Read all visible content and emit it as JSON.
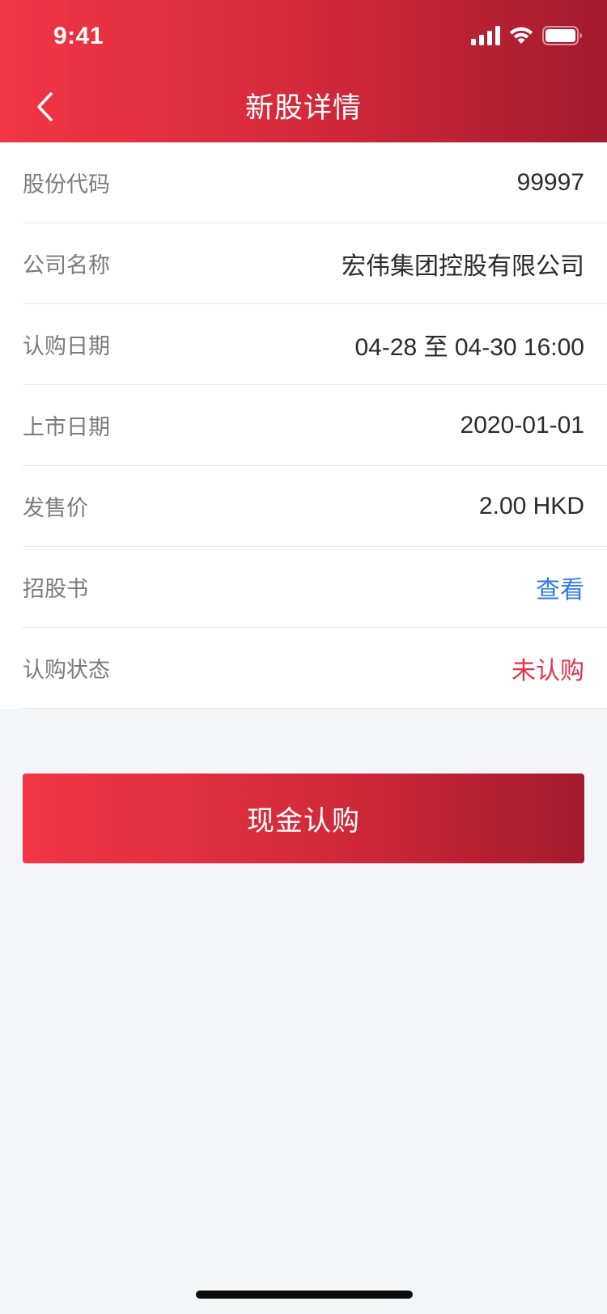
{
  "status_bar": {
    "time": "9:41",
    "icons": [
      "cellular-signal-icon",
      "wifi-icon",
      "battery-icon"
    ]
  },
  "nav": {
    "title": "新股详情",
    "back_icon": "chevron-left-icon"
  },
  "details": [
    {
      "label": "股份代码",
      "value": "99997"
    },
    {
      "label": "公司名称",
      "value": "宏伟集团控股有限公司"
    },
    {
      "label": "认购日期",
      "value": "04-28 至 04-30 16:00"
    },
    {
      "label": "上市日期",
      "value": "2020-01-01"
    },
    {
      "label": "发售价",
      "value": "2.00 HKD"
    },
    {
      "label": "招股书",
      "value": "查看"
    },
    {
      "label": "认购状态",
      "value": "未认购"
    }
  ],
  "action": {
    "label": "现金认购"
  },
  "colors": {
    "accent_start": "#f23645",
    "accent_end": "#a41a2e",
    "link": "#2f7be8",
    "status_red": "#e8304a",
    "background": "#f4f5f8"
  }
}
